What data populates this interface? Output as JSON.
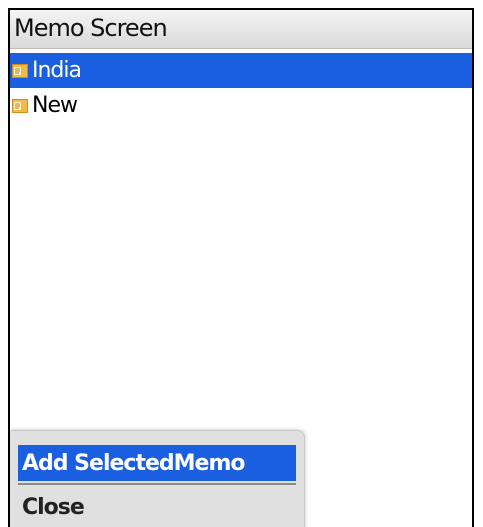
{
  "screen": {
    "title": "Memo Screen"
  },
  "memos": [
    {
      "label": "India",
      "icon": "memo-icon",
      "selected": true
    },
    {
      "label": "New",
      "icon": "memo-icon",
      "selected": false
    }
  ],
  "menu": {
    "items": [
      {
        "label": "Add SelectedMemo",
        "highlighted": true
      },
      {
        "label": "Close",
        "highlighted": false
      }
    ]
  },
  "colors": {
    "selection": "#1a5fe0",
    "title_bar": "#e6e6e6",
    "menu_bg": "#e0e0e0"
  }
}
